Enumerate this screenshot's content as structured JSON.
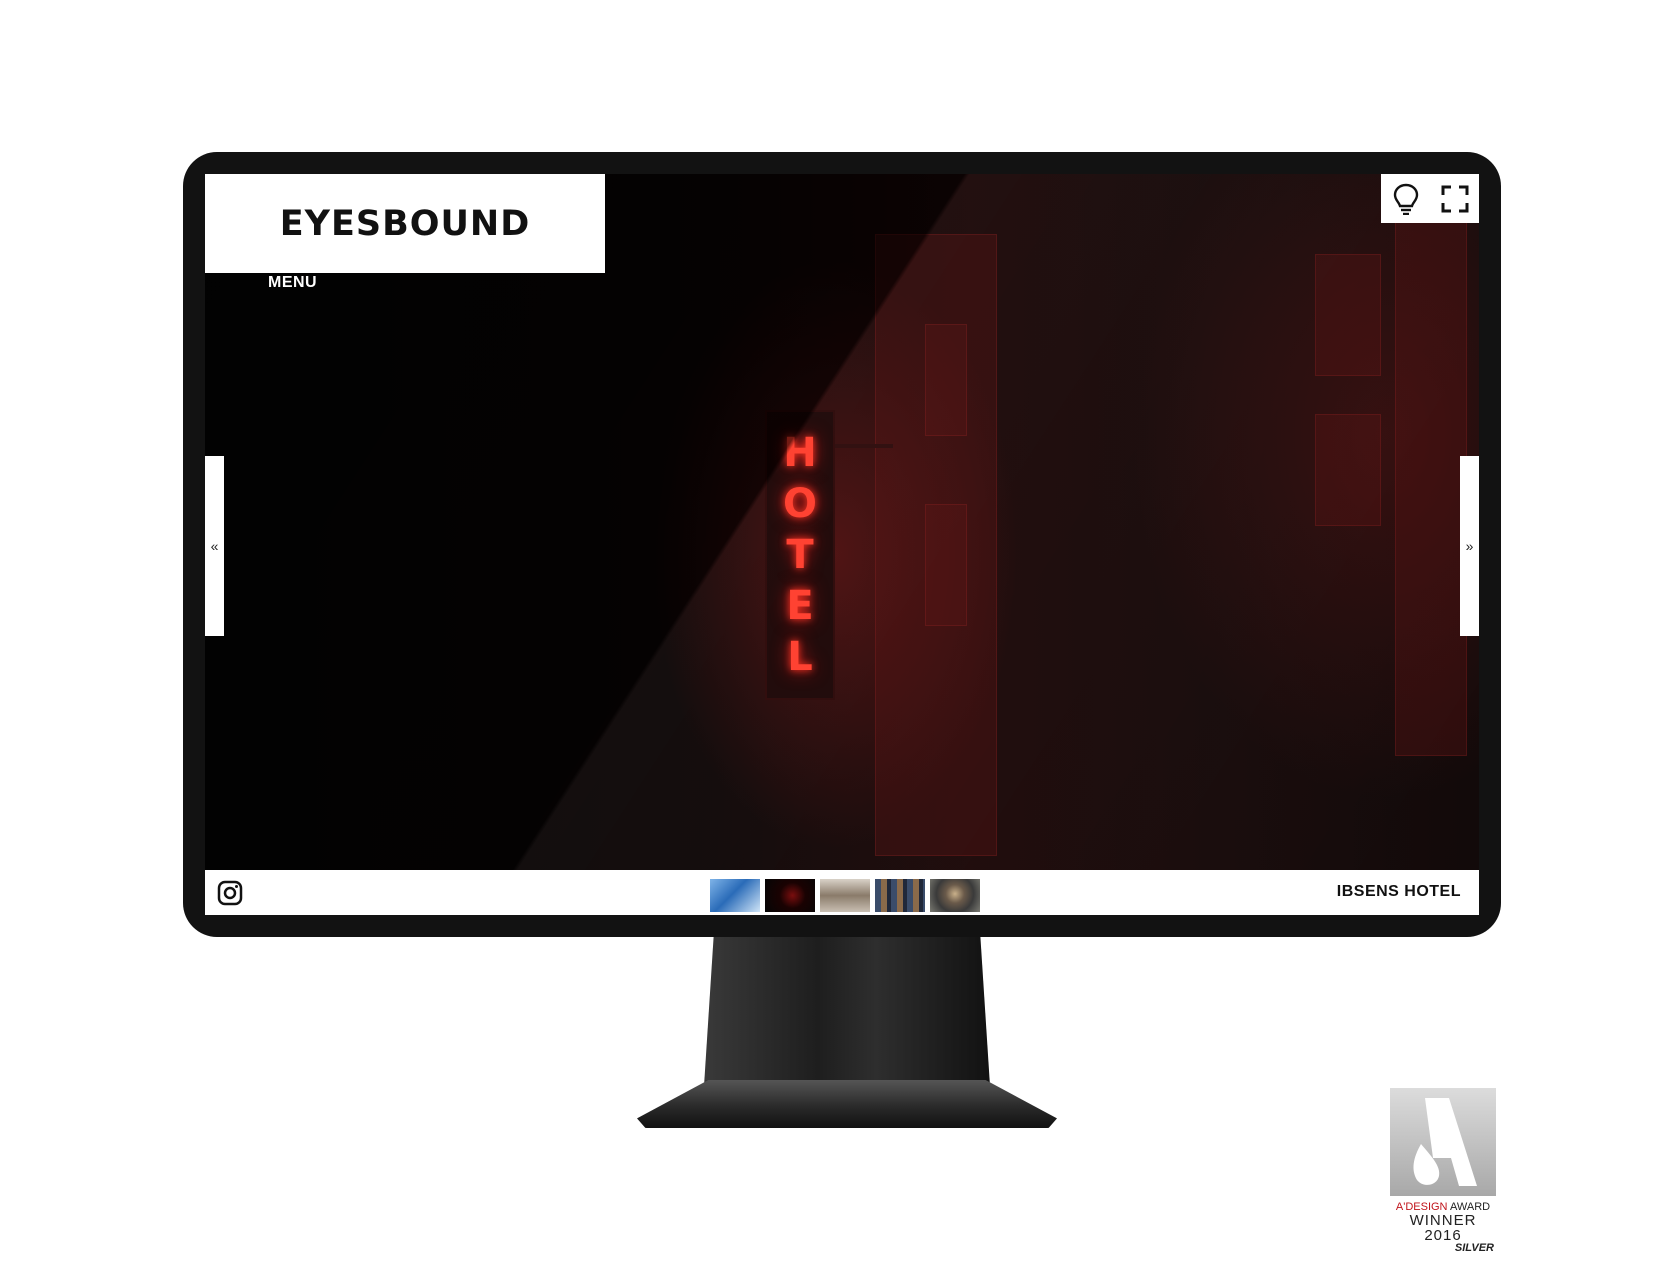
{
  "site": {
    "logo": "EYESBOUND",
    "menu_label": "MENU",
    "prev_arrow": "«",
    "next_arrow": "»",
    "current_project": "IBSENS HOTEL",
    "sign_letters": [
      "H",
      "O",
      "T",
      "E",
      "L"
    ]
  },
  "tools": [
    {
      "name": "lightbulb-icon"
    },
    {
      "name": "fullscreen-icon"
    }
  ],
  "thumbnails": [
    {
      "name": "thumbnail-1"
    },
    {
      "name": "thumbnail-2"
    },
    {
      "name": "thumbnail-3"
    },
    {
      "name": "thumbnail-4"
    },
    {
      "name": "thumbnail-5"
    }
  ],
  "award": {
    "line1_brand": "A'DESIGN",
    "line1_rest": " AWARD",
    "line2": "WINNER 2016",
    "line3": "SILVER"
  },
  "colors": {
    "neon": "#ff3b2a",
    "award_red": "#c0141b",
    "bar": "#ffffff"
  }
}
